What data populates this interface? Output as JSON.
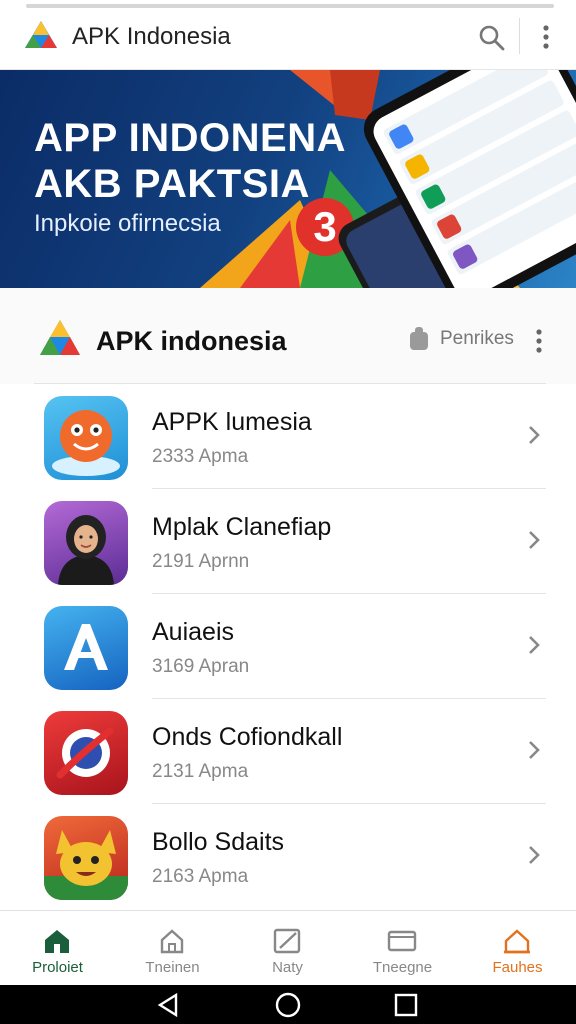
{
  "app_bar": {
    "title": "APK Indonesia",
    "search_icon": "search-icon",
    "more_icon": "more-vert-icon"
  },
  "banner": {
    "headline_1": "APP INDONENA",
    "headline_2": "AKB PAKTSIA",
    "subtitle": "Inpkoie ofirnecsia",
    "badge": "3"
  },
  "section": {
    "title": "APK indonesia",
    "permissions_label": "Penrikes"
  },
  "apps": [
    {
      "name": "APPK lumesia",
      "meta": "2333 Apma",
      "icon": "orange-mascot-icon",
      "color": "#35a8e6"
    },
    {
      "name": "Mplak Clanefiap",
      "meta": "2191 Aprnn",
      "icon": "portrait-icon",
      "color": "#7b3db0"
    },
    {
      "name": "Auiaeis",
      "meta": "3169 Apran",
      "icon": "letter-a-icon",
      "color": "#1b7fd4"
    },
    {
      "name": "Onds Cofiondkall",
      "meta": "2131 Apma",
      "icon": "circle-swoosh-icon",
      "color": "#d8262f"
    },
    {
      "name": "Bollo Sdaits",
      "meta": "2163 Apma",
      "icon": "fox-mascot-icon",
      "color": "#e54d2e"
    }
  ],
  "bottom_nav": [
    {
      "label": "Proloiet",
      "icon": "home-icon",
      "active": true,
      "color": "#1b5e3b"
    },
    {
      "label": "Tneinen",
      "icon": "house-outline-icon",
      "active": false,
      "color": "#888888"
    },
    {
      "label": "Naty",
      "icon": "edit-icon",
      "active": false,
      "color": "#888888"
    },
    {
      "label": "Tneegne",
      "icon": "tablet-icon",
      "active": false,
      "color": "#888888"
    },
    {
      "label": "Fauhes",
      "icon": "favorite-house-icon",
      "active": false,
      "color": "#e2711d"
    }
  ],
  "system_nav": {
    "back_icon": "back-triangle-icon",
    "home_icon": "home-circle-icon",
    "recents_icon": "recents-square-icon"
  }
}
